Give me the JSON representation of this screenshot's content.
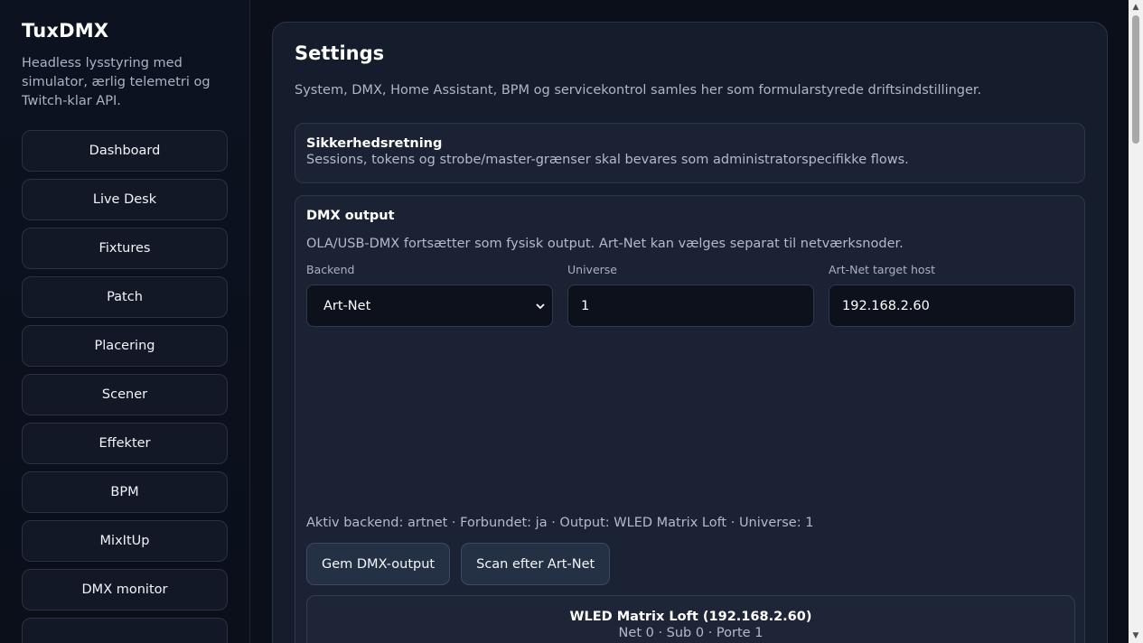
{
  "sidebar": {
    "brand": "TuxDMX",
    "tagline": "Headless lysstyring med simulator, ærlig telemetri og Twitch-klar API.",
    "items": [
      {
        "label": "Dashboard"
      },
      {
        "label": "Live Desk"
      },
      {
        "label": "Fixtures"
      },
      {
        "label": "Patch"
      },
      {
        "label": "Placering"
      },
      {
        "label": "Scener"
      },
      {
        "label": "Effekter"
      },
      {
        "label": "BPM"
      },
      {
        "label": "MixItUp"
      },
      {
        "label": "DMX monitor"
      },
      {
        "label": ""
      }
    ]
  },
  "settings": {
    "title": "Settings",
    "description": "System, DMX, Home Assistant, BPM og servicekontrol samles her som formularstyrede driftsindstillinger.",
    "notice": {
      "title": "Sikkerhedsretning",
      "text": "Sessions, tokens og strobe/master-grænser skal bevares som administratorspecifikke flows."
    },
    "dmx": {
      "title": "DMX output",
      "description": "OLA/USB-DMX fortsætter som fysisk output. Art-Net kan vælges separat til netværksnoder.",
      "backend": {
        "label": "Backend",
        "value": "Art-Net"
      },
      "universe": {
        "label": "Universe",
        "value": "1"
      },
      "target_host": {
        "label": "Art-Net target host",
        "value": "192.168.2.60"
      },
      "status": "Aktiv backend: artnet · Forbundet: ja · Output: WLED Matrix Loft · Universe: 1",
      "save_button": "Gem DMX-output",
      "scan_button": "Scan efter Art-Net",
      "node": {
        "name": "WLED Matrix Loft (192.168.2.60)",
        "meta": "Net 0 · Sub 0 · Porte 1"
      }
    }
  },
  "scrollbar": {
    "up_icon": "▲",
    "down_icon": "▼"
  },
  "icons": {
    "select_chevron": "chevron-down-icon"
  }
}
